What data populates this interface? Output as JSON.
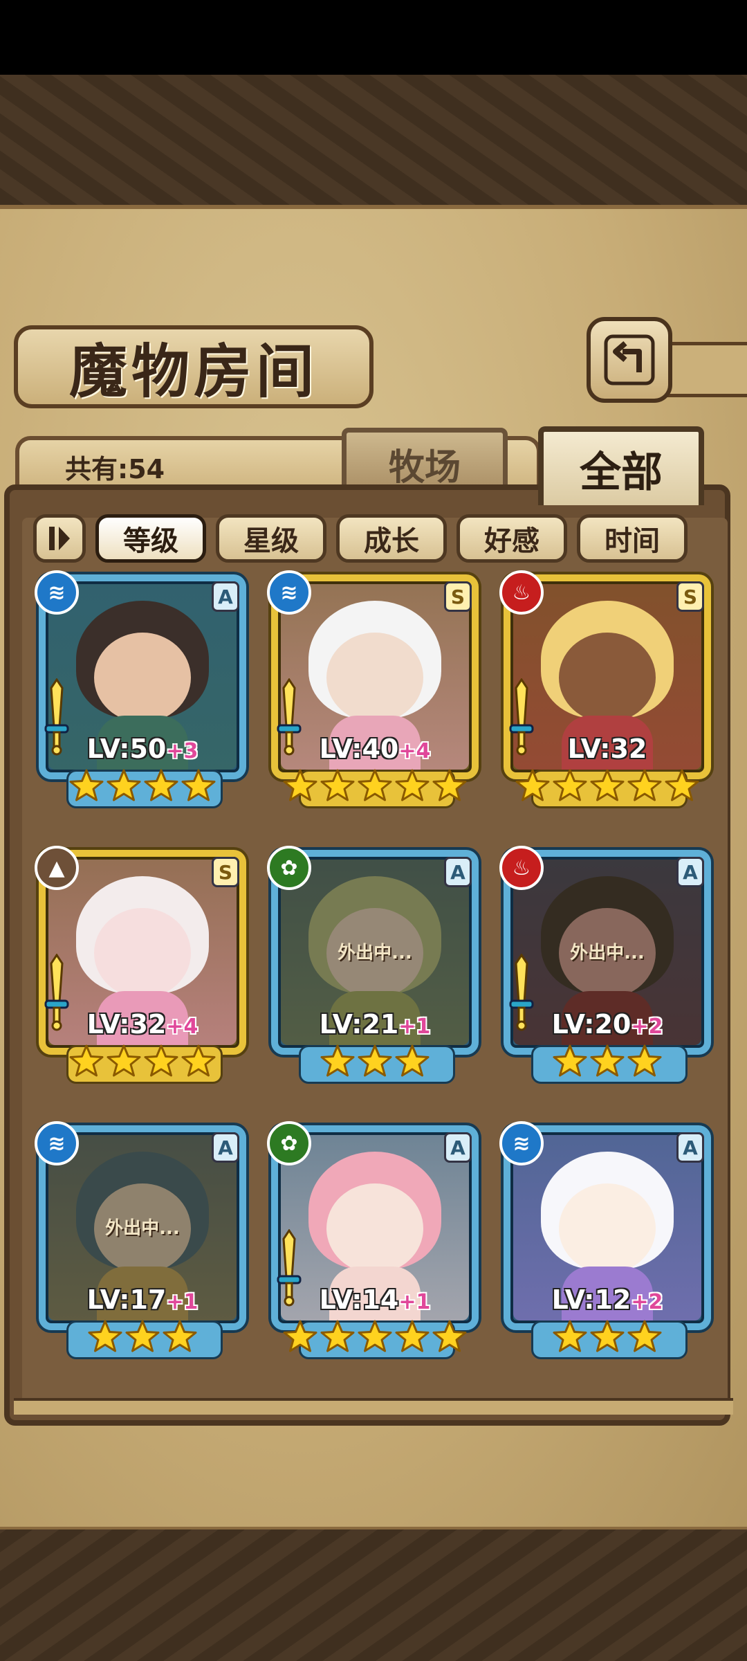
{
  "title": "魔物房间",
  "count_label": "共有:54",
  "tabs": {
    "pasture": "牧场",
    "all": "全部"
  },
  "sort": {
    "toggle_icon": "sort-order-icon",
    "options": [
      "等级",
      "星级",
      "成长",
      "好感",
      "时间"
    ],
    "selected": "等级"
  },
  "back_icon": "back-arrow-icon",
  "colors": {
    "water": "#1f78c8",
    "fire": "#c61e1e",
    "earth": "#6e5038",
    "leaf": "#2d7a22",
    "blue_frame": "#5fb0d8",
    "gold_frame": "#e8c23a",
    "bonus": "#e0489a"
  },
  "monsters": [
    {
      "element": "water",
      "rank": "A",
      "level": "LV:50",
      "bonus": "+3",
      "stars": 4,
      "frame": "blue",
      "equipped": true,
      "away": ""
    },
    {
      "element": "water",
      "rank": "S",
      "level": "LV:40",
      "bonus": "+4",
      "stars": 5,
      "frame": "gold",
      "equipped": true,
      "away": ""
    },
    {
      "element": "fire",
      "rank": "S",
      "level": "LV:32",
      "bonus": "",
      "stars": 5,
      "frame": "gold",
      "equipped": true,
      "away": ""
    },
    {
      "element": "earth",
      "rank": "S",
      "level": "LV:32",
      "bonus": "+4",
      "stars": 4,
      "frame": "gold",
      "equipped": true,
      "away": ""
    },
    {
      "element": "leaf",
      "rank": "A",
      "level": "LV:21",
      "bonus": "+1",
      "stars": 3,
      "frame": "blue",
      "equipped": false,
      "away": "外出中..."
    },
    {
      "element": "fire",
      "rank": "A",
      "level": "LV:20",
      "bonus": "+2",
      "stars": 3,
      "frame": "blue",
      "equipped": true,
      "away": "外出中..."
    },
    {
      "element": "water",
      "rank": "A",
      "level": "LV:17",
      "bonus": "+1",
      "stars": 3,
      "frame": "blue",
      "equipped": false,
      "away": "外出中..."
    },
    {
      "element": "leaf",
      "rank": "A",
      "level": "LV:14",
      "bonus": "+1",
      "stars": 5,
      "frame": "blue",
      "equipped": true,
      "away": ""
    },
    {
      "element": "water",
      "rank": "A",
      "level": "LV:12",
      "bonus": "+2",
      "stars": 3,
      "frame": "blue",
      "equipped": false,
      "away": ""
    }
  ]
}
